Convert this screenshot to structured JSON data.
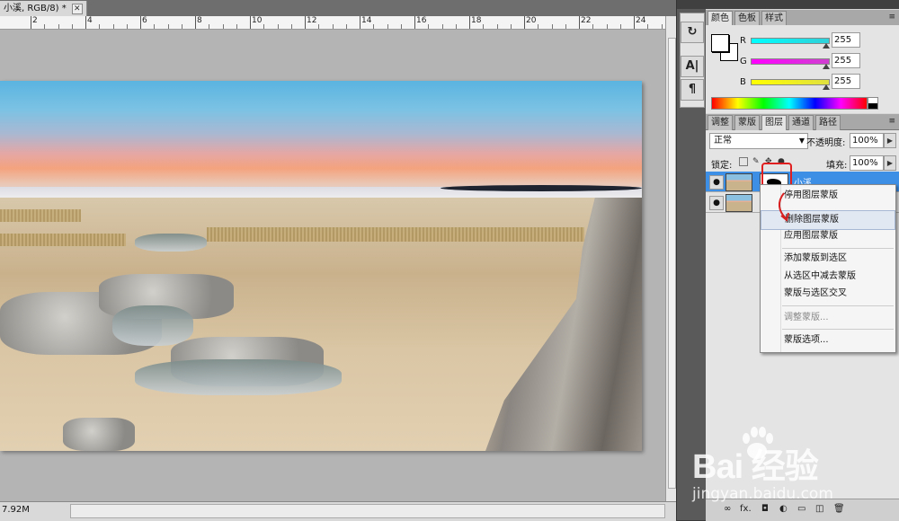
{
  "document": {
    "tab_title": "小溪, RGB/8) *",
    "close_label": "✕",
    "ruler_labels": [
      "2",
      "4",
      "6",
      "8",
      "10",
      "12",
      "14",
      "16",
      "18",
      "20",
      "22",
      "24"
    ],
    "status_zoom": "7.92M"
  },
  "toolstrip": {
    "btn1": "↻",
    "btn2": "A|",
    "btn3": "¶"
  },
  "color_panel": {
    "tabs": [
      "颜色",
      "色板",
      "样式"
    ],
    "channels": [
      {
        "label": "R",
        "value": "255",
        "color": "#30d0d8"
      },
      {
        "label": "G",
        "value": "255",
        "color": "#d040d0"
      },
      {
        "label": "B",
        "value": "255",
        "color": "#e0e040"
      }
    ],
    "menu_icon": "≡"
  },
  "layers_panel": {
    "tabs": [
      "调整",
      "蒙版",
      "图层",
      "通道",
      "路径"
    ],
    "active_tab": "图层",
    "blend_mode": "正常",
    "opacity_label": "不透明度:",
    "opacity_value": "100%",
    "lock_label": "锁定:",
    "fill_label": "填充:",
    "fill_value": "100%",
    "layers": [
      {
        "name": "小溪",
        "selected": true
      },
      {
        "name": "",
        "selected": false
      }
    ],
    "eye_icon": "●",
    "bottom_icons": [
      "∞",
      "fx.",
      "◘",
      "◐",
      "▭",
      "◫",
      "🗑"
    ]
  },
  "context_menu": {
    "items": [
      {
        "label": "停用图层蒙版",
        "disabled": false,
        "highlight": false
      },
      {
        "label": "删除图层蒙版",
        "disabled": false,
        "highlight": true
      },
      {
        "label": "应用图层蒙版",
        "disabled": false,
        "highlight": false
      },
      {
        "label": "添加蒙版到选区",
        "disabled": false,
        "highlight": false
      },
      {
        "label": "从选区中减去蒙版",
        "disabled": false,
        "highlight": false
      },
      {
        "label": "蒙版与选区交叉",
        "disabled": false,
        "highlight": false
      },
      {
        "label": "调整蒙版...",
        "disabled": true,
        "highlight": false
      },
      {
        "label": "蒙版选项...",
        "disabled": false,
        "highlight": false
      }
    ]
  },
  "watermark": {
    "big": "Bai 经验",
    "small": "jingyan.baidu.com"
  }
}
